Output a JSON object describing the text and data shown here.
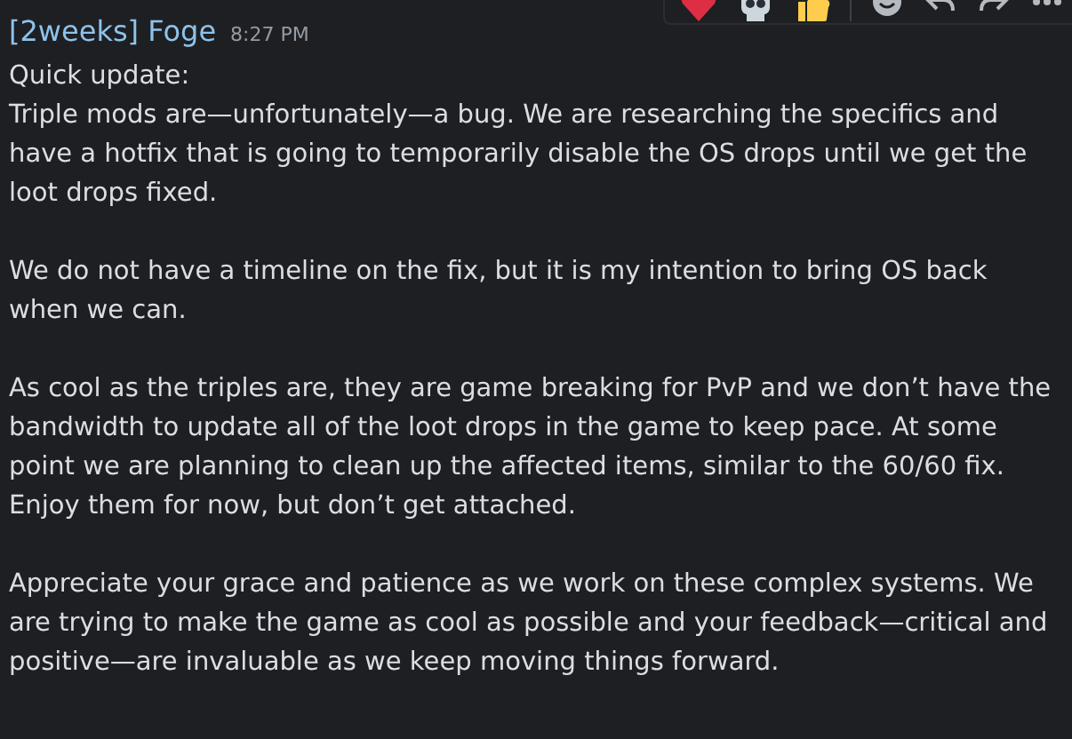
{
  "message": {
    "author": "[2weeks] Foge",
    "time": "8:27 PM",
    "paragraphs": [
      "Quick update:\nTriple mods are—unfortunately—a bug. We are researching the specifics and have a hotfix that is going to temporarily disable the OS drops until we get the loot drops fixed.",
      "We do not have a timeline on the fix, but it is my intention to bring OS back when we can.",
      "As cool as the triples are, they are game breaking for PvP and we don’t have the bandwidth to update all of the loot drops in the game to keep pace. At some point we are planning to clean up the affected items, similar to the 60/60 fix. Enjoy them for now, but don’t get attached.",
      "Appreciate your grace and patience as we work on these complex systems. We are trying to make the game as cool as possible and your feedback—critical and positive—are invaluable as we keep moving things forward."
    ]
  }
}
